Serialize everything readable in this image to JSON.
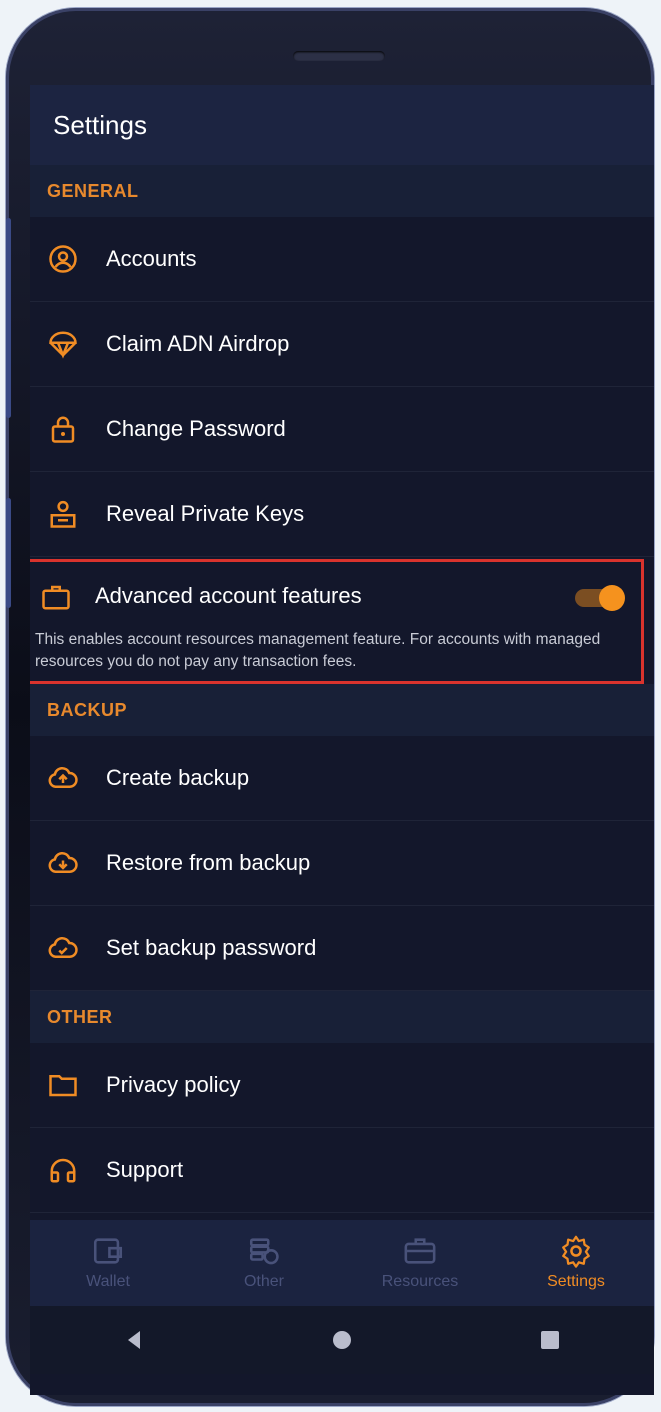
{
  "header": {
    "title": "Settings"
  },
  "sections": {
    "general": {
      "label": "GENERAL",
      "items": [
        {
          "label": "Accounts",
          "icon": "user-circle-icon"
        },
        {
          "label": "Claim ADN Airdrop",
          "icon": "parachute-icon"
        },
        {
          "label": "Change Password",
          "icon": "lock-icon"
        },
        {
          "label": "Reveal Private Keys",
          "icon": "user-key-icon"
        }
      ],
      "advanced": {
        "label": "Advanced account features",
        "description": "This enables account resources management feature. For accounts with managed resources you do not pay any transaction fees.",
        "enabled": true
      }
    },
    "backup": {
      "label": "BACKUP",
      "items": [
        {
          "label": "Create backup",
          "icon": "cloud-upload-icon"
        },
        {
          "label": "Restore from backup",
          "icon": "cloud-download-icon"
        },
        {
          "label": "Set backup password",
          "icon": "cloud-check-icon"
        }
      ]
    },
    "other": {
      "label": "OTHER",
      "items": [
        {
          "label": "Privacy policy",
          "icon": "folder-icon"
        },
        {
          "label": "Support",
          "icon": "headphones-icon"
        }
      ]
    }
  },
  "tabs": [
    {
      "label": "Wallet",
      "icon": "wallet-icon",
      "active": false
    },
    {
      "label": "Other",
      "icon": "coins-icon",
      "active": false
    },
    {
      "label": "Resources",
      "icon": "briefcase-icon",
      "active": false
    },
    {
      "label": "Settings",
      "icon": "gear-icon",
      "active": true
    }
  ],
  "colors": {
    "accent": "#f08c24",
    "background": "#13172b",
    "header": "#1c2441",
    "highlight_border": "#d9332d"
  }
}
